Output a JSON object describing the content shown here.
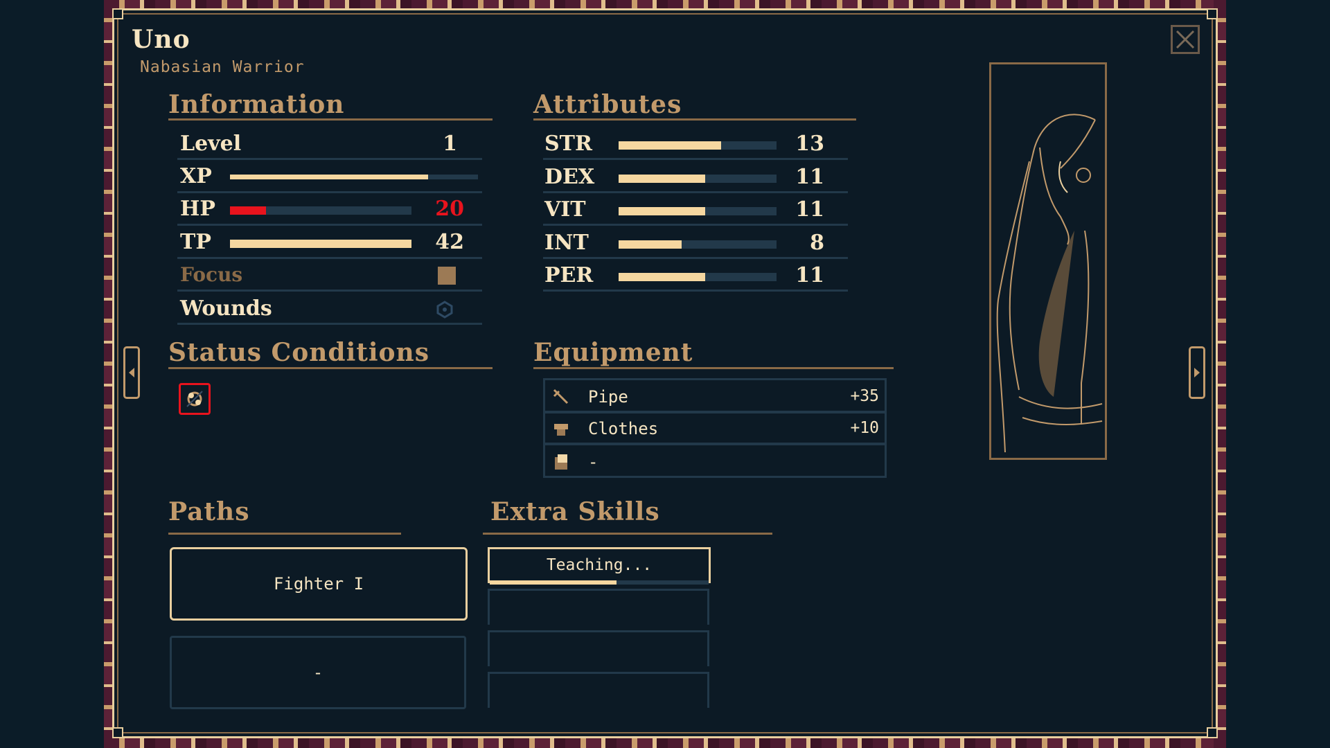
{
  "character": {
    "name": "Uno",
    "class": "Nabasian Warrior"
  },
  "sections": {
    "information": "Information",
    "attributes": "Attributes",
    "status_conditions": "Status Conditions",
    "equipment": "Equipment",
    "paths": "Paths",
    "extra_skills": "Extra Skills"
  },
  "information": {
    "level": {
      "label": "Level",
      "value": "1"
    },
    "xp": {
      "label": "XP",
      "progress": 0.8
    },
    "hp": {
      "label": "HP",
      "value": "20",
      "progress": 0.2,
      "color": "#e8131d"
    },
    "tp": {
      "label": "TP",
      "value": "42",
      "progress": 1.0
    },
    "focus": {
      "label": "Focus"
    },
    "wounds": {
      "label": "Wounds"
    }
  },
  "attributes": [
    {
      "label": "STR",
      "value": "13",
      "progress": 0.65
    },
    {
      "label": "DEX",
      "value": "11",
      "progress": 0.55
    },
    {
      "label": "VIT",
      "value": "11",
      "progress": 0.55
    },
    {
      "label": "INT",
      "value": "8",
      "progress": 0.4
    },
    {
      "label": "PER",
      "value": "11",
      "progress": 0.55
    }
  ],
  "status_conditions": [
    {
      "icon": "status-effect-icon"
    }
  ],
  "equipment": [
    {
      "icon": "pipe-weapon-icon",
      "name": "Pipe",
      "bonus": "+35"
    },
    {
      "icon": "clothes-armor-icon",
      "name": "Clothes",
      "bonus": "+10"
    },
    {
      "icon": "accessory-icon",
      "name": "-",
      "bonus": ""
    }
  ],
  "paths": [
    {
      "label": "Fighter I"
    },
    {
      "label": "-"
    }
  ],
  "extra_skills": [
    {
      "label": "Teaching...",
      "progress": 0.58
    }
  ],
  "colors": {
    "accent": "#f5d7a0",
    "bronze": "#c29a6b",
    "track": "#22394a",
    "bg": "#0c1a25",
    "hp": "#e8131d"
  }
}
